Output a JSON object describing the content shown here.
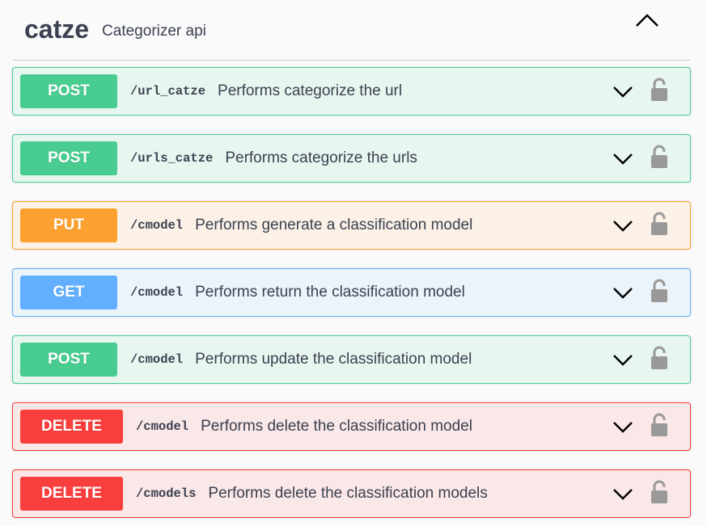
{
  "tag": {
    "name": "catze",
    "description": "Categorizer api"
  },
  "operations": [
    {
      "method": "POST",
      "path": "/url_catze",
      "summary": "Performs categorize the url"
    },
    {
      "method": "POST",
      "path": "/urls_catze",
      "summary": "Performs categorize the urls"
    },
    {
      "method": "PUT",
      "path": "/cmodel",
      "summary": "Performs generate a classification model"
    },
    {
      "method": "GET",
      "path": "/cmodel",
      "summary": "Performs return the classification model"
    },
    {
      "method": "POST",
      "path": "/cmodel",
      "summary": "Performs update the classification model"
    },
    {
      "method": "DELETE",
      "path": "/cmodel",
      "summary": "Performs delete the classification model"
    },
    {
      "method": "DELETE",
      "path": "/cmodels",
      "summary": "Performs delete the classification models"
    }
  ],
  "icons": {
    "collapse": "chevron-up-icon",
    "expand": "chevron-down-icon",
    "auth": "lock-icon"
  },
  "colors": {
    "post": "#49cc90",
    "put": "#fca130",
    "get": "#61affe",
    "delete": "#f93e3e",
    "lock": "#999999"
  }
}
